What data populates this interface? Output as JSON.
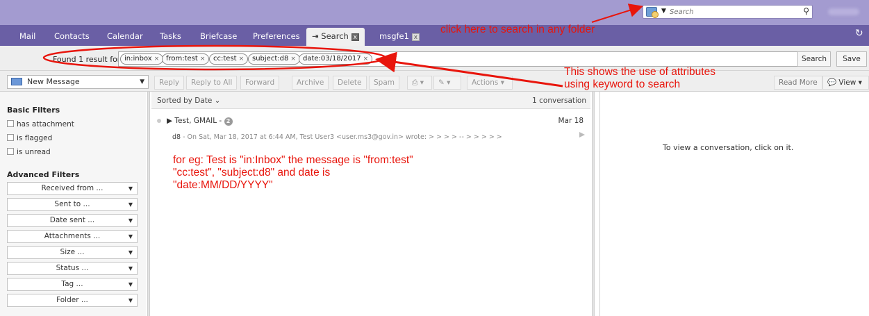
{
  "top": {
    "search_placeholder": "Search",
    "search_icon": "magnifier-icon",
    "folder_icon": "folder-search-icon"
  },
  "tabs": [
    {
      "label": "Mail"
    },
    {
      "label": "Contacts"
    },
    {
      "label": "Calendar"
    },
    {
      "label": "Tasks"
    },
    {
      "label": "Briefcase"
    },
    {
      "label": "Preferences"
    },
    {
      "label": "Search",
      "close": "x"
    },
    {
      "label": "msgfe1",
      "close": "x"
    }
  ],
  "search_results": {
    "found_text": "Found 1 result for:",
    "chips": [
      "in:inbox",
      "from:test",
      "cc:test",
      "subject:d8",
      "date:03/18/2017"
    ],
    "search_button": "Search",
    "save_button": "Save"
  },
  "toolbar": {
    "new_message": "New Message",
    "buttons": [
      "Reply",
      "Reply to All",
      "Forward",
      "Archive",
      "Delete",
      "Spam",
      "Actions"
    ],
    "read_more": "Read More",
    "view": "View"
  },
  "sidebar": {
    "basic_filters": "Basic Filters",
    "checkboxes": [
      "has attachment",
      "is flagged",
      "is unread"
    ],
    "advanced_filters": "Advanced Filters",
    "filters": [
      "Received from ...",
      "Sent to ...",
      "Date sent ...",
      "Attachments ...",
      "Size ...",
      "Status ...",
      "Tag ...",
      "Folder ..."
    ]
  },
  "list": {
    "sorted_by": "Sorted by Date",
    "count": "1 conversation",
    "message": {
      "from": "Test, GMAIL -",
      "badge": "2",
      "date": "Mar 18",
      "subject": "d8",
      "snippet": "- On Sat, Mar 18, 2017 at 6:44 AM, Test User3 <user.ms3@gov.in> wrote: > > > > -- > > > > >"
    }
  },
  "reading_pane": {
    "empty_text": "To view a conversation, click on it."
  },
  "annotations": {
    "folder_hint": "click here to search in any folder",
    "attr_hint_line1": "This shows the use of attributes",
    "attr_hint_line2": "using keyword to search",
    "example_line1": "for eg: Test is \"in:Inbox\" the message is \"from:test\"",
    "example_line2": "\"cc:test\", \"subject:d8\" and date is",
    "example_line3": "\"date:MM/DD/YYYY\"",
    "color": "#e8150c"
  }
}
